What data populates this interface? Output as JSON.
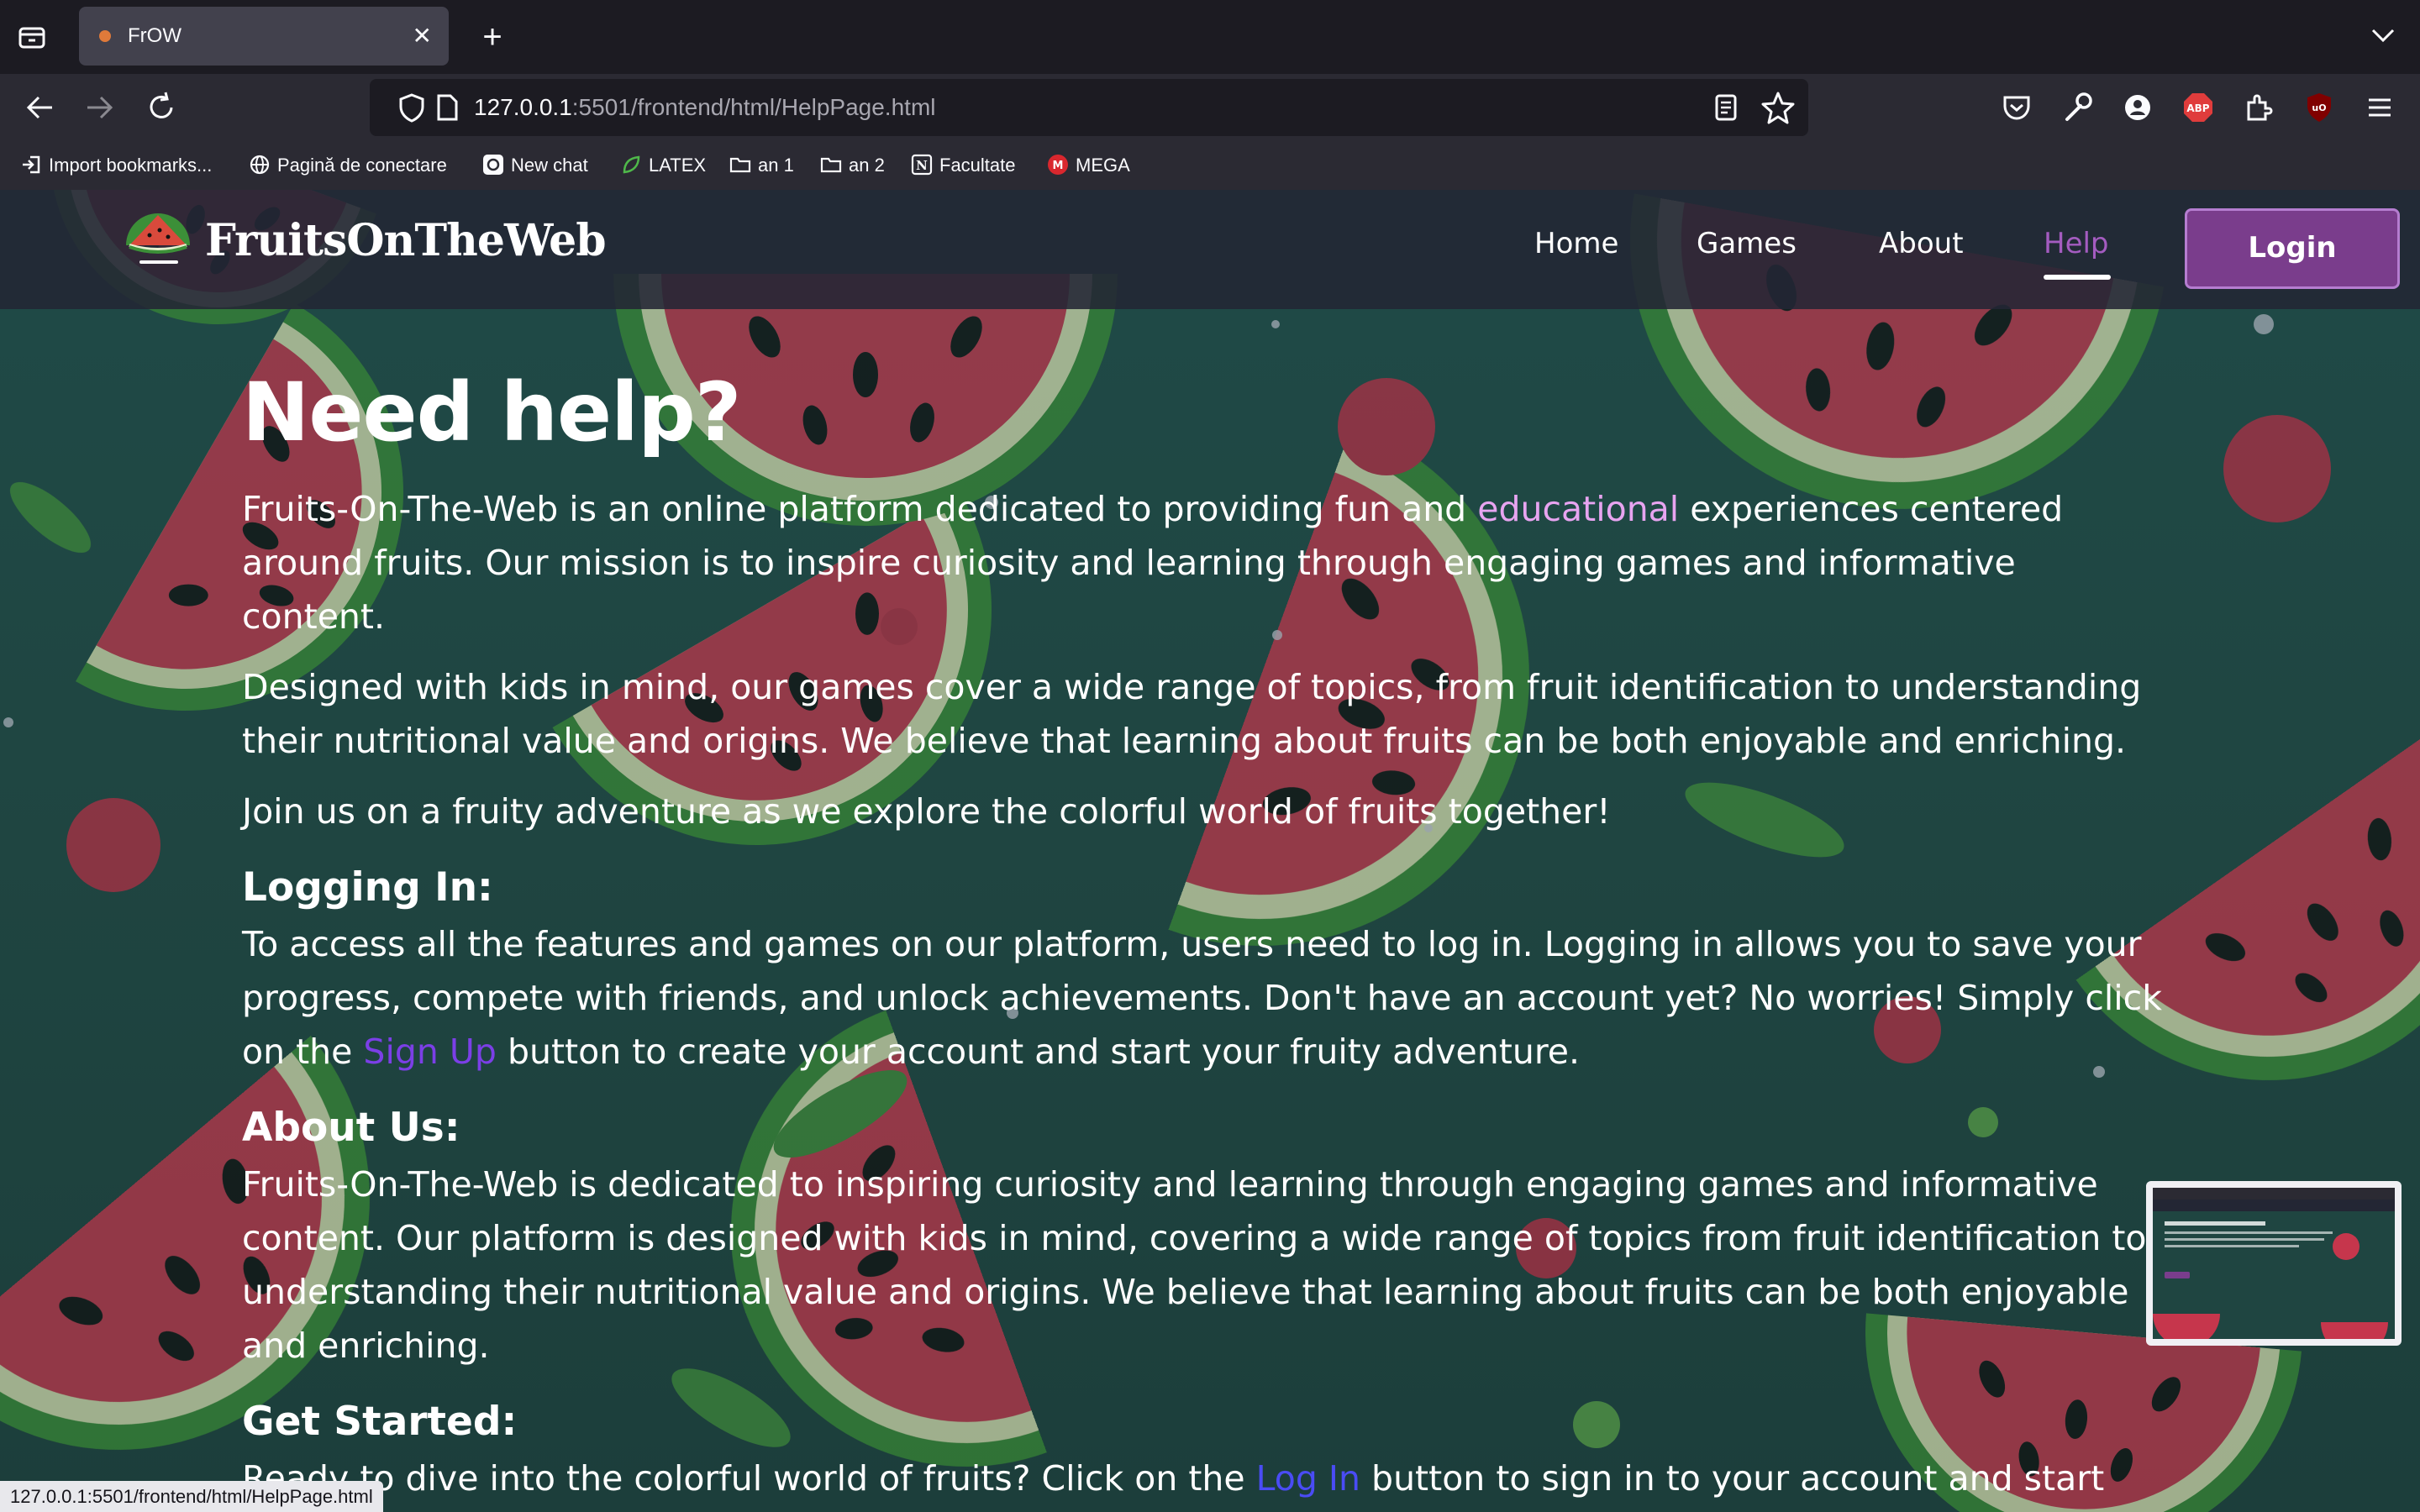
{
  "browser": {
    "tab_title": "FrOW",
    "url_host": "127.0.0.1",
    "url_path": ":5501/frontend/html/HelpPage.html",
    "bookmarks": [
      "Import bookmarks...",
      "Pagină de conectare",
      "New chat",
      "LATEX",
      "an 1",
      "an 2",
      "Facultate",
      "MEGA"
    ],
    "status_url": "127.0.0.1:5501/frontend/html/HelpPage.html",
    "icons": [
      "tab-manager-icon",
      "back-icon",
      "forward-icon",
      "reload-icon",
      "shield-icon",
      "page-icon",
      "reader-icon",
      "star-icon",
      "pocket-icon",
      "wrench-icon",
      "account-icon",
      "adblock-icon",
      "extensions-icon",
      "ublock-icon",
      "menu-icon"
    ]
  },
  "site": {
    "logo_text": "FruitsOnTheWeb",
    "nav": [
      "Home",
      "Games",
      "About",
      "Help"
    ],
    "active_nav": "Help",
    "login_label": "Login"
  },
  "content": {
    "title": "Need help?",
    "intro_1a": "Fruits-On-The-Web is an online platform dedicated to providing fun and ",
    "intro_1_link": "educational",
    "intro_1b": " experiences centered around fruits. Our mission is to inspire curiosity and learning through engaging games and informative content.",
    "intro_2": "Designed with kids in mind, our games cover a wide range of topics, from fruit identification to understanding their nutritional value and origins. We believe that learning about fruits can be both enjoyable and enriching.",
    "intro_3": "Join us on a fruity adventure as we explore the colorful world of fruits together!",
    "logging_heading": "Logging In:",
    "logging_a": "To access all the features and games on our platform, users need to log in. Logging in allows you to save your progress, compete with friends, and unlock achievements. Don't have an account yet? No worries! Simply click on the ",
    "logging_link": "Sign Up",
    "logging_b": " button to create your account and start your fruity adventure.",
    "about_heading": "About Us:",
    "about_text": "Fruits-On-The-Web is dedicated to inspiring curiosity and learning through engaging games and informative content. Our platform is designed with kids in mind, covering a wide range of topics from fruit identification to understanding their nutritional value and origins. We believe that learning about fruits can be both enjoyable and enriching.",
    "started_heading": "Get Started:",
    "started_a": "Ready to dive into the colorful world of fruits? Click on the ",
    "started_link": "Log In",
    "started_b": " button to sign in to your account and start"
  },
  "colors": {
    "page_bg": "#1f4541",
    "header_bg": "#232634",
    "active_nav": "#a45cc0",
    "login_bg": "#7a3d8c",
    "link_purple": "#7b3fe6",
    "link_blue": "#4a4cf5"
  }
}
